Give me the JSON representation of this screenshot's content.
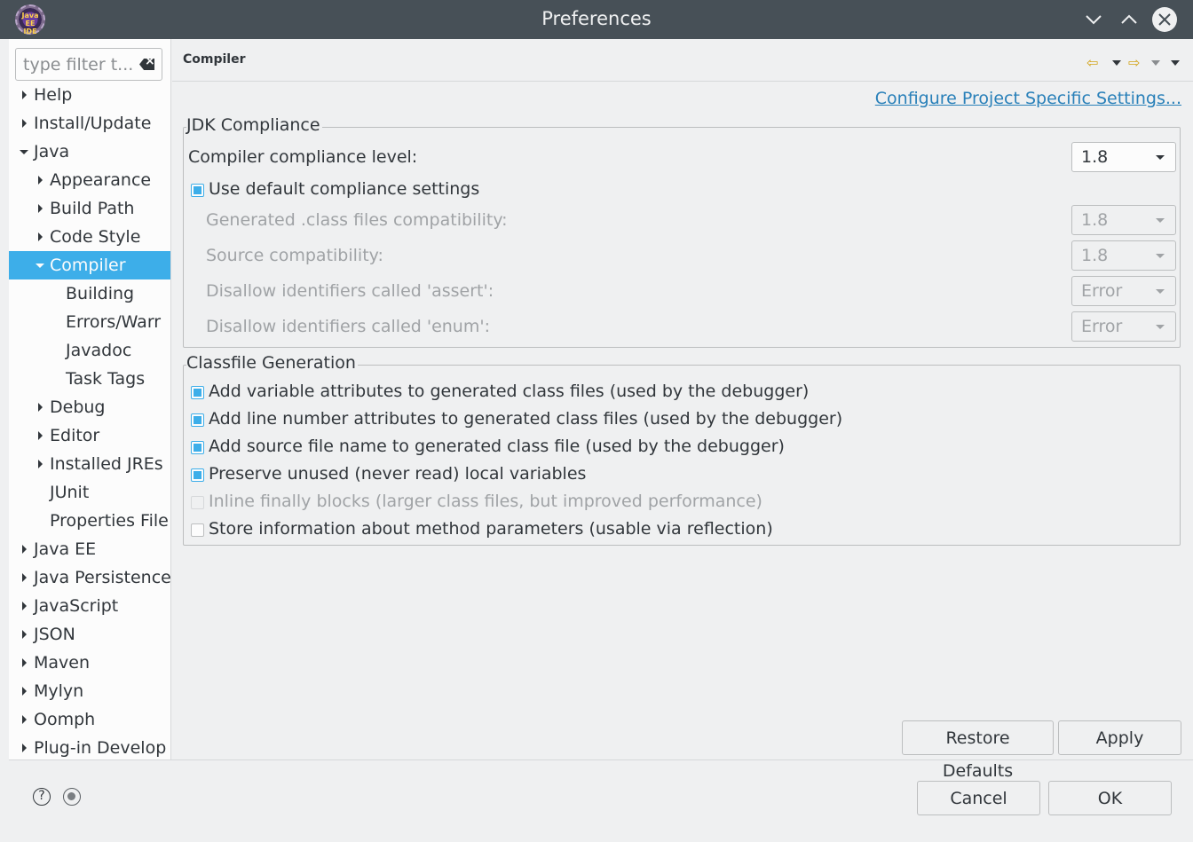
{
  "window": {
    "title": "Preferences",
    "app_icon_text": "Java EE IDE"
  },
  "filter": {
    "placeholder": "type filter t..."
  },
  "tree": {
    "items": [
      {
        "label": "Help",
        "level": 0,
        "expander": "collapsed"
      },
      {
        "label": "Install/Update",
        "level": 0,
        "expander": "collapsed"
      },
      {
        "label": "Java",
        "level": 0,
        "expander": "expanded"
      },
      {
        "label": "Appearance",
        "level": 1,
        "expander": "collapsed"
      },
      {
        "label": "Build Path",
        "level": 1,
        "expander": "collapsed"
      },
      {
        "label": "Code Style",
        "level": 1,
        "expander": "collapsed"
      },
      {
        "label": "Compiler",
        "level": 1,
        "expander": "expanded",
        "selected": true
      },
      {
        "label": "Building",
        "level": 2,
        "expander": "none"
      },
      {
        "label": "Errors/Warr",
        "level": 2,
        "expander": "none"
      },
      {
        "label": "Javadoc",
        "level": 2,
        "expander": "none"
      },
      {
        "label": "Task Tags",
        "level": 2,
        "expander": "none"
      },
      {
        "label": "Debug",
        "level": 1,
        "expander": "collapsed"
      },
      {
        "label": "Editor",
        "level": 1,
        "expander": "collapsed"
      },
      {
        "label": "Installed JREs",
        "level": 1,
        "expander": "collapsed"
      },
      {
        "label": "JUnit",
        "level": 1,
        "expander": "none"
      },
      {
        "label": "Properties File",
        "level": 1,
        "expander": "none"
      },
      {
        "label": "Java EE",
        "level": 0,
        "expander": "collapsed"
      },
      {
        "label": "Java Persistence",
        "level": 0,
        "expander": "collapsed"
      },
      {
        "label": "JavaScript",
        "level": 0,
        "expander": "collapsed"
      },
      {
        "label": "JSON",
        "level": 0,
        "expander": "collapsed"
      },
      {
        "label": "Maven",
        "level": 0,
        "expander": "collapsed"
      },
      {
        "label": "Mylyn",
        "level": 0,
        "expander": "collapsed"
      },
      {
        "label": "Oomph",
        "level": 0,
        "expander": "collapsed"
      },
      {
        "label": "Plug-in Develop",
        "level": 0,
        "expander": "collapsed"
      }
    ]
  },
  "page": {
    "title": "Compiler",
    "config_link": "Configure Project Specific Settings..."
  },
  "jdk": {
    "group_title": "JDK Compliance",
    "compliance_label": "Compiler compliance level:",
    "compliance_value": "1.8",
    "use_default_label": "Use default compliance settings",
    "use_default_checked": true,
    "generated_label": "Generated .class files compatibility:",
    "generated_value": "1.8",
    "source_label": "Source compatibility:",
    "source_value": "1.8",
    "assert_label": "Disallow identifiers called 'assert':",
    "assert_value": "Error",
    "enum_label": "Disallow identifiers called 'enum':",
    "enum_value": "Error"
  },
  "classfile": {
    "group_title": "Classfile Generation",
    "options": [
      {
        "label": "Add variable attributes to generated class files (used by the debugger)",
        "checked": true,
        "enabled": true
      },
      {
        "label": "Add line number attributes to generated class files (used by the debugger)",
        "checked": true,
        "enabled": true
      },
      {
        "label": "Add source file name to generated class file (used by the debugger)",
        "checked": true,
        "enabled": true
      },
      {
        "label": "Preserve unused (never read) local variables",
        "checked": true,
        "enabled": true
      },
      {
        "label": "Inline finally blocks (larger class files, but improved performance)",
        "checked": false,
        "enabled": false
      },
      {
        "label": "Store information about method parameters (usable via reflection)",
        "checked": false,
        "enabled": true
      }
    ]
  },
  "buttons": {
    "restore_defaults": "Restore Defaults",
    "apply": "Apply",
    "cancel": "Cancel",
    "ok": "OK"
  },
  "footer": {
    "help_icon_glyph": "?"
  },
  "colors": {
    "titlebar": "#475057",
    "selection": "#3daee9",
    "link": "#2980b9"
  }
}
